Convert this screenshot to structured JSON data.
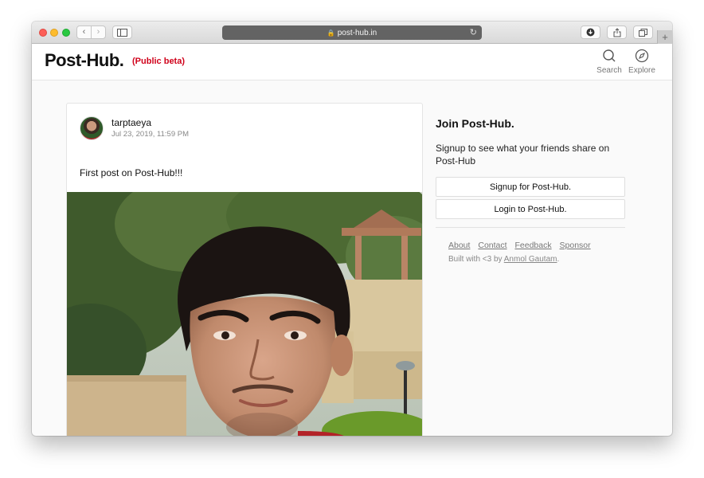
{
  "browser": {
    "url": "post-hub.in",
    "nav_back": "‹",
    "nav_forward": "›",
    "new_tab": "+"
  },
  "header": {
    "logo": "Post-Hub.",
    "beta_label": "(Public beta)",
    "search_label": "Search",
    "explore_label": "Explore"
  },
  "post": {
    "username": "tarptaeya",
    "timestamp": "Jul 23, 2019, 11:59 PM",
    "caption": "First post on Post-Hub!!!"
  },
  "sidebar": {
    "title": "Join Post-Hub.",
    "text": "Signup to see what your friends share on Post-Hub",
    "signup_label": "Signup for Post-Hub.",
    "login_label": "Login to Post-Hub.",
    "footer_links": [
      "About",
      "Contact",
      "Feedback",
      "Sponsor"
    ],
    "credit_prefix": "Built with <3 by ",
    "credit_author": "Anmol Gautam",
    "credit_suffix": "."
  },
  "colors": {
    "beta_red": "#d0021b",
    "text": "#111111",
    "muted": "#888888"
  }
}
